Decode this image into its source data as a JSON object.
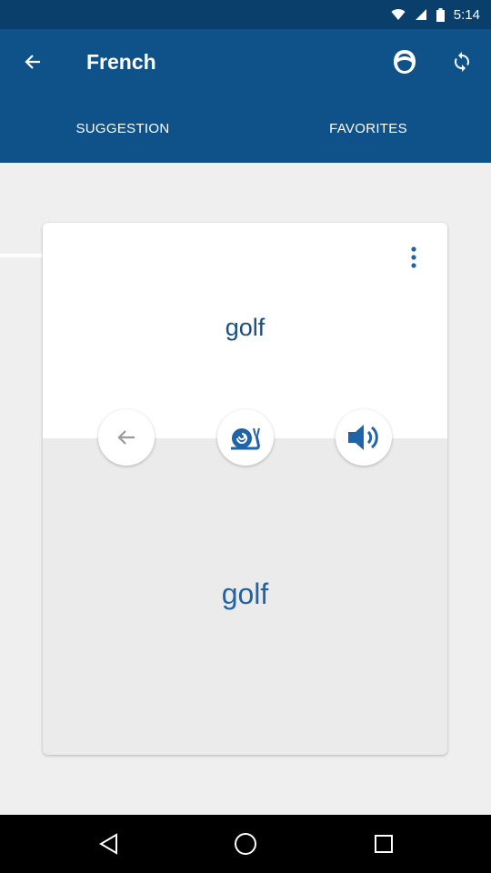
{
  "status_bar": {
    "time": "5:14"
  },
  "app_bar": {
    "title": "French"
  },
  "tabs": [
    {
      "label": "SUGGESTION",
      "selected": true
    },
    {
      "label": "FAVORITES",
      "selected": false
    }
  ],
  "card": {
    "front_word": "golf",
    "back_word": "golf"
  },
  "colors": {
    "app_bar": "#0e5289",
    "status_bar": "#0b3f6b",
    "word": "#1f63a8"
  },
  "icons": {
    "back": "arrow-left-icon",
    "profile": "profile-icon",
    "refresh": "refresh-icon",
    "more": "more-vert-icon",
    "previous": "arrow-left-icon",
    "slow": "snail-icon",
    "sound": "speaker-icon"
  }
}
